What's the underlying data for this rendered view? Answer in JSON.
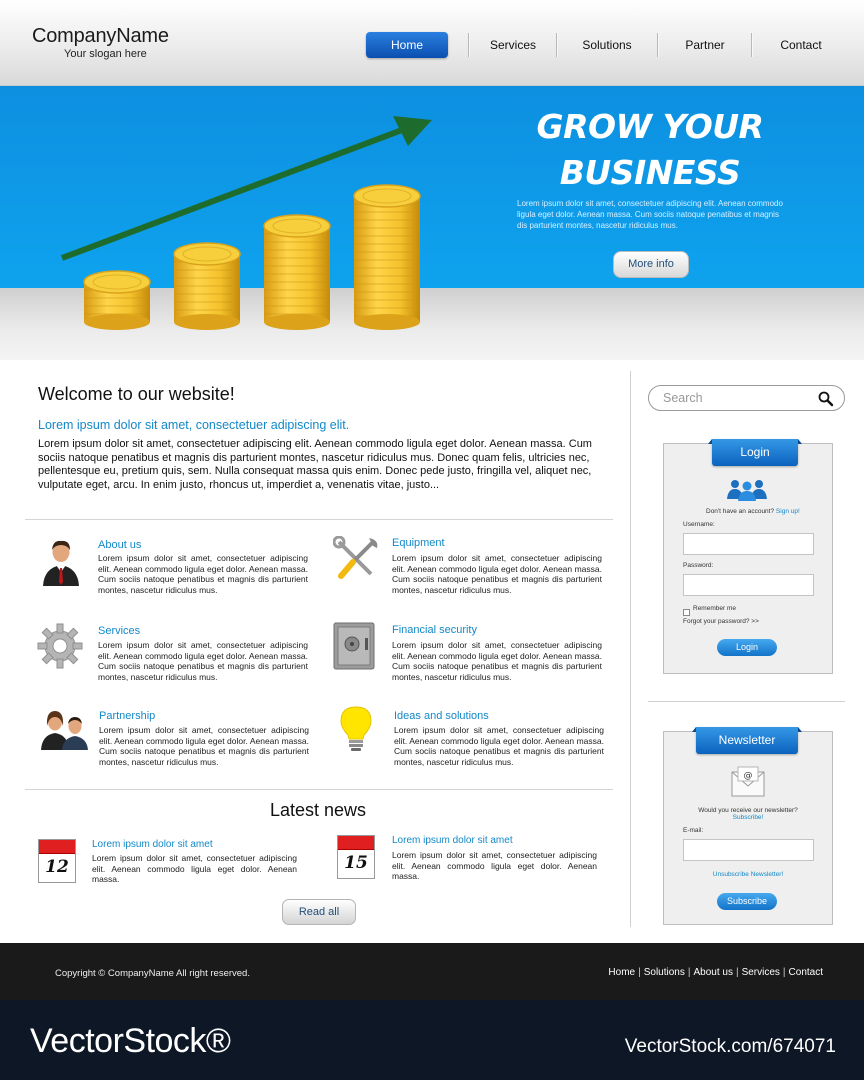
{
  "header": {
    "company_name": "CompanyName",
    "slogan": "Your slogan here",
    "nav": [
      "Home",
      "Services",
      "Solutions",
      "Partner",
      "Contact"
    ],
    "active_nav": "Home"
  },
  "hero": {
    "title_line1": "GROW YOUR",
    "title_line2": "BUSINESS",
    "text": "Lorem ipsum dolor sit amet, consectetuer adipiscing elit. Aenean commodo ligula eget dolor. Aenean massa. Cum sociis natoque penatibus et magnis dis parturient montes, nascetur ridiculus mus.",
    "button": "More info"
  },
  "welcome": {
    "title": "Welcome to our website!",
    "subtitle": "Lorem ipsum dolor sit amet, consectetuer adipiscing elit.",
    "body": "Lorem ipsum dolor sit amet, consectetuer adipiscing elit. Aenean commodo ligula eget dolor. Aenean massa. Cum sociis natoque penatibus et magnis dis parturient montes, nascetur ridiculus mus. Donec quam felis, ultricies nec, pellentesque eu, pretium quis, sem. Nulla consequat massa quis enim. Donec pede justo, fringilla vel, aliquet nec, vulputate eget, arcu. In enim justo, rhoncus ut, imperdiet a, venenatis vitae, justo..."
  },
  "features": [
    {
      "title": "About us",
      "icon": "businessman-icon",
      "text": "Lorem ipsum dolor sit amet, consectetuer adipiscing elit. Aenean commodo ligula eget dolor. Aenean massa. Cum sociis natoque penatibus et magnis dis parturient montes, nascetur ridiculus mus."
    },
    {
      "title": "Equipment",
      "icon": "tools-icon",
      "text": "Lorem ipsum dolor sit amet, consectetuer adipiscing elit. Aenean commodo ligula eget dolor. Aenean massa. Cum sociis natoque penatibus et magnis dis parturient montes, nascetur ridiculus mus."
    },
    {
      "title": "Services",
      "icon": "gear-icon",
      "text": "Lorem ipsum dolor sit amet, consectetuer adipiscing elit. Aenean commodo ligula eget dolor. Aenean massa. Cum sociis natoque penatibus et magnis dis parturient montes, nascetur ridiculus mus."
    },
    {
      "title": "Financial security",
      "icon": "safe-icon",
      "text": "Lorem ipsum dolor sit amet, consectetuer adipiscing elit. Aenean commodo ligula eget dolor. Aenean massa. Cum sociis natoque penatibus et magnis dis parturient montes, nascetur ridiculus mus."
    },
    {
      "title": "Partnership",
      "icon": "partners-icon",
      "text": "Lorem ipsum dolor sit amet, consectetuer adipiscing elit. Aenean commodo ligula eget dolor. Aenean massa. Cum sociis natoque penatibus et magnis dis parturient montes, nascetur ridiculus mus."
    },
    {
      "title": "Ideas and solutions",
      "icon": "lightbulb-icon",
      "text": "Lorem ipsum dolor sit amet, consectetuer adipiscing elit. Aenean commodo ligula eget dolor. Aenean massa. Cum sociis natoque penatibus et magnis dis parturient montes, nascetur ridiculus mus."
    }
  ],
  "news": {
    "heading": "Latest news",
    "items": [
      {
        "day": "12",
        "title": "Lorem ipsum dolor sit amet",
        "text": "Lorem ipsum dolor sit amet, consectetuer adipiscing elit. Aenean commodo ligula eget dolor. Aenean massa."
      },
      {
        "day": "15",
        "title": "Lorem ipsum dolor sit amet",
        "text": "Lorem ipsum dolor sit amet, consectetuer adipiscing elit. Aenean commodo ligula eget dolor. Aenean massa."
      }
    ],
    "read_all": "Read all"
  },
  "sidebar": {
    "search_placeholder": "Search",
    "login": {
      "title": "Login",
      "no_account": "Don't have an account?",
      "sign_up": "Sign up!",
      "username_label": "Username:",
      "password_label": "Password:",
      "remember": "Remember me",
      "forgot": "Forgot your password? >>",
      "button": "Login"
    },
    "newsletter": {
      "title": "Newsletter",
      "question": "Would you receive our newsletter?",
      "subscribe_link": "Subscribe!",
      "email_label": "E-mail:",
      "unsubscribe": "Unsubscribe Newsletter!",
      "button": "Subscribe"
    }
  },
  "footer": {
    "copyright": "Copyright © CompanyName All right reserved.",
    "links": [
      "Home",
      "Solutions",
      "About us",
      "Services",
      "Contact"
    ]
  },
  "watermark": {
    "logo": "VectorStock®",
    "id": "VectorStock.com/674071"
  },
  "colors": {
    "accent_blue": "#1388c8",
    "hero_blue": "#0ea3ee",
    "button_blue": "#1273c8",
    "arrow_green": "#1e6b2e",
    "coin_gold": "#f2c12e",
    "footer_dark": "#1a1a1a"
  }
}
